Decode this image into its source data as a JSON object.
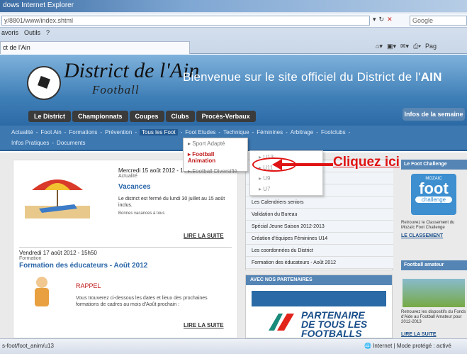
{
  "browser": {
    "title": "dows Internet Explorer",
    "url": "y/8801/www/index.shtml",
    "search_placeholder": "Google",
    "menu": [
      "avoris",
      "Outils",
      "?"
    ],
    "tab_title": "ct de l'Ain",
    "page_menu": "Pag"
  },
  "site": {
    "logo_title": "District de l'Ain",
    "logo_sub": "Football",
    "welcome": "Bienvenue sur le site officiel du District de l'",
    "welcome_bold": "AIN",
    "top_nav": [
      "Le District",
      "Championnats",
      "Coupes",
      "Clubs",
      "Procès-Verbaux"
    ],
    "infos_semaine": "Infos de la semaine",
    "main_nav_row1": [
      "Actualité",
      "-",
      "Foot Ain",
      "-",
      "Formations",
      "-",
      "Prévention",
      "-",
      "Tous les Foot",
      "-",
      "Foot Etudes",
      "-",
      "Technique",
      "-",
      "Féminines",
      "-",
      "Arbitrage",
      "-",
      "Footclubs",
      "-"
    ],
    "main_nav_row2": [
      "Infos Pratiques",
      "-",
      "Documents"
    ],
    "dropdown": [
      "Sport Adapté",
      "Football Animation",
      "Football Diversifié"
    ]
  },
  "articles": {
    "a1_date": "Mercredi 15 août 2012 - 16h00",
    "a1_cat": "Actualité",
    "a1_title": "Vacances",
    "a1_text": "Le district est fermé du lundi 30 juillet au 15 août inclus.",
    "a1_small": "Bonnes vacances à tous",
    "a1_more": "LIRE LA SUITE",
    "a2_date": "Vendredi 17 août 2012 - 15h50",
    "a2_cat": "Formation",
    "a2_title": "Formation des éducateurs - Août 2012",
    "a2_rappel": "RAPPEL",
    "a2_text": "Vous trouverez ci-dessous les dates et lieux des prochaines formations de cadres au mois d'Août prochain :",
    "a2_more": "LIRE LA SUITE"
  },
  "middle": {
    "sub_items": [
      "U13",
      "U11",
      "U9",
      "U7"
    ],
    "list": [
      "Les Calendriers seniors",
      "Validation du Bureau",
      "Spécial Jeune Saison 2012-2013",
      "Création d'équipes Féminines U14",
      "Les coordonnées du District",
      "Formation des éducateurs - Août 2012"
    ],
    "partners_head": "AVEC NOS PARTENAIRES",
    "partner_logo_line1": "PARTENAIRE",
    "partner_logo_line2": "DE TOUS LES",
    "partner_logo_line3": "FOOTBALLS"
  },
  "right": {
    "fc_head": "Le Foot Challenge",
    "fc_small": "MOZAIC",
    "fc_big": "foot",
    "fc_sub": "challenge",
    "fc_text": "Retrouvez le Classement du Mozaïc Foot Challenge",
    "fc_link": "LE CLASSEMENT",
    "fa_head": "Football amateur",
    "fa_text": "Retrouvez les dispositifs du Fonds d'Aide au Football Amateur pour 2012-2013",
    "fa_link": "LIRE LA SUITE"
  },
  "annotation": {
    "label": "Cliquez ici"
  },
  "status": {
    "left": "s-foot/foot_anim/u13",
    "right": "Internet | Mode protégé : activé"
  }
}
